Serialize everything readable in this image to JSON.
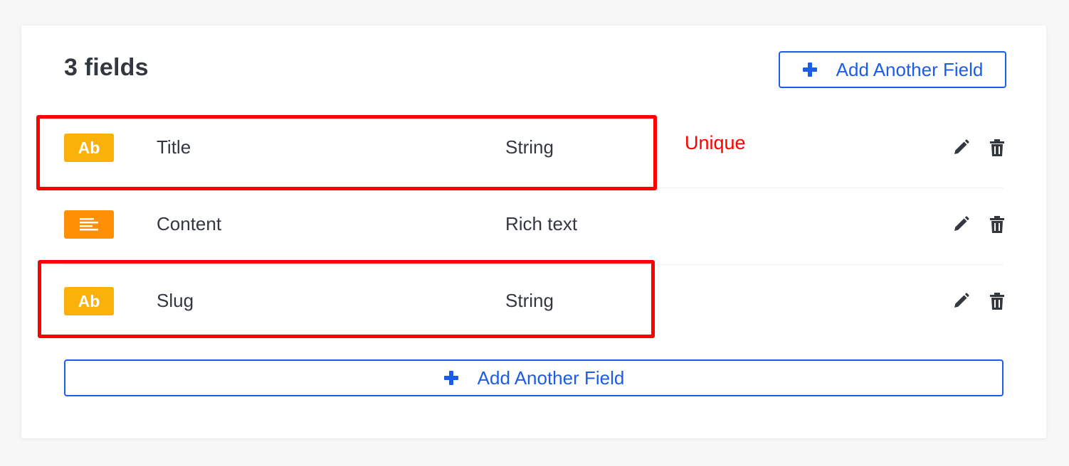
{
  "header": {
    "title": "3 fields",
    "add_button_label": "Add Another Field"
  },
  "fields": [
    {
      "badge": "Ab",
      "badge_type": "string",
      "name": "Title",
      "type": "String"
    },
    {
      "badge": "",
      "badge_type": "richtext",
      "name": "Content",
      "type": "Rich text"
    },
    {
      "badge": "Ab",
      "badge_type": "string",
      "name": "Slug",
      "type": "String"
    }
  ],
  "footer": {
    "add_button_label": "Add Another Field"
  },
  "annotation": {
    "text": "Unique",
    "color": "#ff0000"
  },
  "colors": {
    "accent": "#1c5de7",
    "string_badge": "#fab20a",
    "richtext_badge": "#ff8f04",
    "text": "#333740"
  },
  "icons": [
    "plus-icon",
    "pencil-icon",
    "trash-icon",
    "align-left-icon"
  ]
}
